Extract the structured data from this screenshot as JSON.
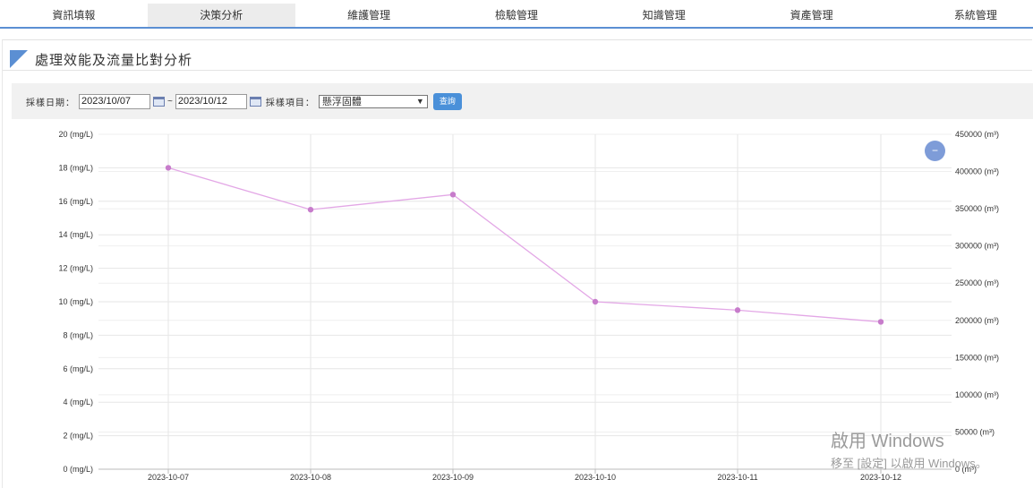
{
  "nav": {
    "items": [
      "資訊填報",
      "決策分析",
      "維護管理",
      "檢驗管理",
      "知識管理",
      "資產管理",
      "系統管理"
    ],
    "active_index": 1
  },
  "panel": {
    "title": "處理效能及流量比對分析"
  },
  "filter": {
    "date_label": "採樣日期：",
    "start_date": "2023/10/07",
    "separator": "~",
    "end_date": "2023/10/12",
    "item_label": "採樣項目：",
    "item_selected": "懸浮固體",
    "query_label": "查詢"
  },
  "chart_data": {
    "type": "line",
    "categories": [
      "2023-10-07",
      "2023-10-08",
      "2023-10-09",
      "2023-10-10",
      "2023-10-11",
      "2023-10-12"
    ],
    "series": [
      {
        "name": "",
        "axis": "left",
        "values": [
          18.0,
          15.5,
          16.4,
          10.0,
          9.5,
          8.8
        ],
        "color": "#c77ccb"
      }
    ],
    "y_left": {
      "min": 0,
      "max": 20,
      "ticks": [
        "0 (mg/L)",
        "2 (mg/L)",
        "4 (mg/L)",
        "6 (mg/L)",
        "8 (mg/L)",
        "10 (mg/L)",
        "12 (mg/L)",
        "14 (mg/L)",
        "16 (mg/L)",
        "18 (mg/L)",
        "20 (mg/L)"
      ]
    },
    "y_right": {
      "min": 0,
      "max": 450000,
      "ticks": [
        "0 (m³)",
        "50000 (m³)",
        "100000 (m³)",
        "150000 (m³)",
        "200000 (m³)",
        "250000 (m³)",
        "300000 (m³)",
        "350000 (m³)",
        "400000 (m³)",
        "450000 (m³)"
      ]
    },
    "grid": true
  },
  "controls": {
    "collapse_icon": "minus-icon",
    "collapse_glyph": "−"
  },
  "watermark": {
    "line1": "啟用 Windows",
    "line2": "移至 [設定] 以啟用 Windows。"
  }
}
